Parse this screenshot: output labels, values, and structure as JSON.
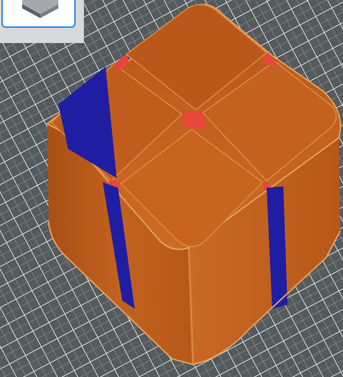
{
  "viewport": {
    "grid_color": "#e3e7ea",
    "bed_color": "#555a5d"
  },
  "model": {
    "wall_color": "#c6621c",
    "seam_color": "#1f1ea3",
    "divider_color": "#e8463c"
  },
  "navigation": {
    "view_cube_icon": "view-cube-icon"
  }
}
